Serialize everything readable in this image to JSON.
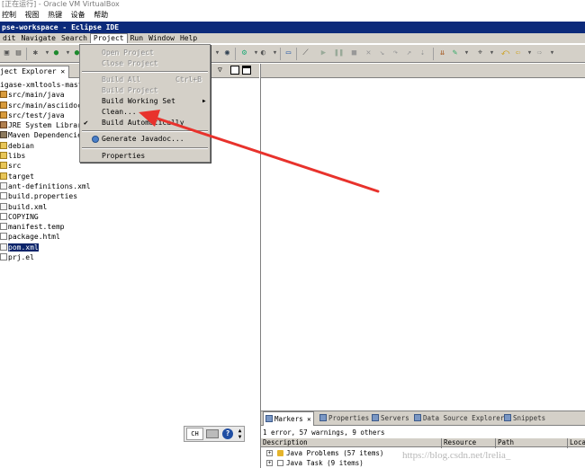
{
  "vbox": {
    "title": "[正在运行] - Oracle VM VirtualBox",
    "menu": [
      "控制",
      "视图",
      "热键",
      "设备",
      "帮助"
    ]
  },
  "eclipse": {
    "title": "pse-workspace - Eclipse IDE",
    "menu": [
      "dit",
      "Navigate",
      "Search",
      "Project",
      "Run",
      "Window",
      "Help"
    ],
    "active_menu_index": 3
  },
  "project_menu": {
    "items": [
      {
        "label": "Open Project",
        "enabled": false
      },
      {
        "label": "Close Project",
        "enabled": false
      },
      {
        "label": "Build All",
        "shortcut": "Ctrl+B",
        "enabled": false
      },
      {
        "label": "Build Project",
        "enabled": false
      },
      {
        "label": "Build Working Set",
        "enabled": true,
        "submenu": true
      },
      {
        "label": "Clean...",
        "enabled": true
      },
      {
        "label": "Build Automatically",
        "enabled": true,
        "checked": true
      },
      {
        "label": "Generate Javadoc...",
        "enabled": true
      },
      {
        "label": "Properties",
        "enabled": true
      }
    ]
  },
  "package_explorer": {
    "tab_label": "ject Explorer ✕",
    "items": [
      {
        "label": "igase-xmltools-master",
        "icon": "project"
      },
      {
        "label": "src/main/java",
        "icon": "pkg"
      },
      {
        "label": "src/main/asciidoc",
        "icon": "pkg"
      },
      {
        "label": "src/test/java",
        "icon": "pkg"
      },
      {
        "label": "JRE System Library [",
        "icon": "jar"
      },
      {
        "label": "Maven Dependencies",
        "icon": "lib"
      },
      {
        "label": "debian",
        "icon": "folder"
      },
      {
        "label": "libs",
        "icon": "folder"
      },
      {
        "label": "src",
        "icon": "folder"
      },
      {
        "label": "target",
        "icon": "folder"
      },
      {
        "label": "ant-definitions.xml",
        "icon": "xml"
      },
      {
        "label": "build.properties",
        "icon": "file"
      },
      {
        "label": "build.xml",
        "icon": "xml"
      },
      {
        "label": "COPYING",
        "icon": "file"
      },
      {
        "label": "manifest.temp",
        "icon": "file"
      },
      {
        "label": "package.html",
        "icon": "file"
      },
      {
        "label": "pom.xml",
        "icon": "xml",
        "selected": true
      },
      {
        "label": "prj.el",
        "icon": "file"
      }
    ]
  },
  "markers": {
    "tabs": [
      "Markers ✕",
      "Properties",
      "Servers",
      "Data Source Explorer",
      "Snippets"
    ],
    "summary": "1 error, 57 warnings, 9 others",
    "columns": [
      "Description",
      "Resource",
      "Path",
      "Loca"
    ],
    "rows": [
      {
        "label": "Java Problems (57 items)",
        "icon": "warning"
      },
      {
        "label": "Java Task (9 items)",
        "icon": "task"
      }
    ]
  },
  "ime": {
    "lang": "CH",
    "help": "?"
  },
  "watermark": "https://blog.csdn.net/lrelia_"
}
